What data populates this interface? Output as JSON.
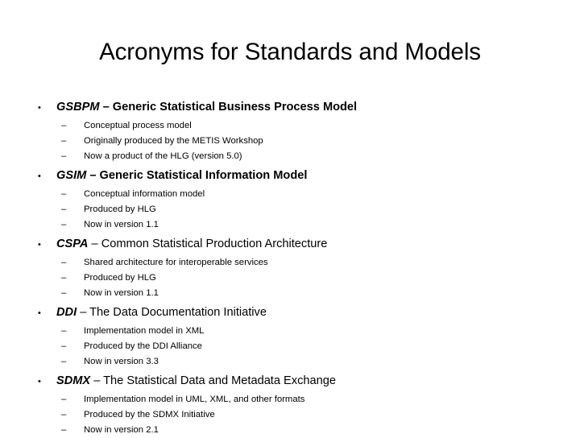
{
  "slide": {
    "title": "Acronyms for Standards and Models",
    "bullet_marker": "•",
    "sub_bullet_marker": "–",
    "text_color": "#000000",
    "background_color": "#ffffff",
    "groups": [
      {
        "acronym": "GSBPM",
        "separator": " – ",
        "expansion": "Generic Statistical Business Process Model",
        "expansion_bold": true,
        "sub_items": [
          "Conceptual process model",
          "Originally produced by the METIS Workshop",
          "Now a product of the HLG (version 5.0)"
        ]
      },
      {
        "acronym": "GSIM",
        "separator": " – ",
        "expansion": "Generic Statistical Information Model",
        "expansion_bold": true,
        "sub_items": [
          "Conceptual information model",
          "Produced by HLG",
          "Now in version 1.1"
        ]
      },
      {
        "acronym": "CSPA",
        "separator": " – ",
        "expansion": "Common Statistical Production Architecture",
        "expansion_bold": false,
        "sub_items": [
          "Shared architecture for interoperable services",
          "Produced by HLG",
          "Now in version 1.1"
        ]
      },
      {
        "acronym": "DDI",
        "separator": " – ",
        "expansion": "The Data Documentation Initiative",
        "expansion_bold": false,
        "sub_items": [
          "Implementation model in XML",
          "Produced by the DDI Alliance",
          "Now in version 3.3"
        ]
      },
      {
        "acronym": "SDMX",
        "separator": " – ",
        "expansion": "The Statistical Data and Metadata Exchange",
        "expansion_bold": false,
        "sub_items": [
          "Implementation model in UML, XML, and other formats",
          "Produced by the SDMX Initiative",
          "Now in version 2.1"
        ]
      }
    ]
  }
}
